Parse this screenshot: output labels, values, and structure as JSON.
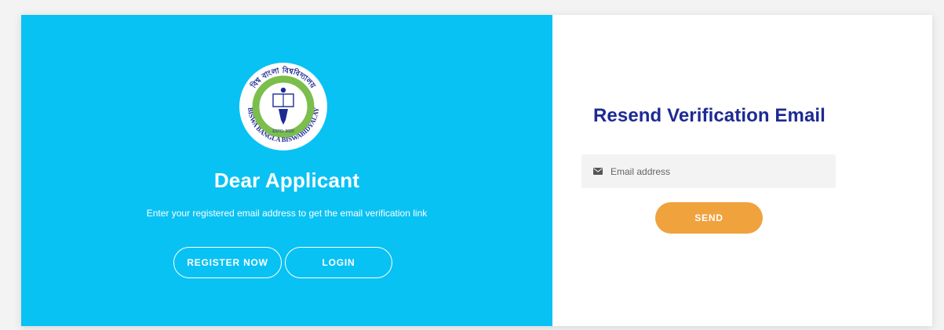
{
  "left_panel": {
    "logo": {
      "top_text": "বিশ্ব বাংলা বিশ্ববিদ্যালয়",
      "bottom_text": "BISWA BANGLA BISWABIDYALAY",
      "inner_text": "ESTD. 2020"
    },
    "heading": "Dear Applicant",
    "subtext": "Enter your registered email address to get the email verification link",
    "register_label": "REGISTER NOW",
    "login_label": "LOGIN"
  },
  "right_panel": {
    "title": "Resend Verification Email",
    "email": {
      "placeholder": "Email address",
      "value": ""
    },
    "send_label": "SEND"
  },
  "colors": {
    "left_bg": "#08c2f4",
    "title": "#1d2a94",
    "send_button": "#f0a23d",
    "logo_ring": "#7bbe4c"
  }
}
